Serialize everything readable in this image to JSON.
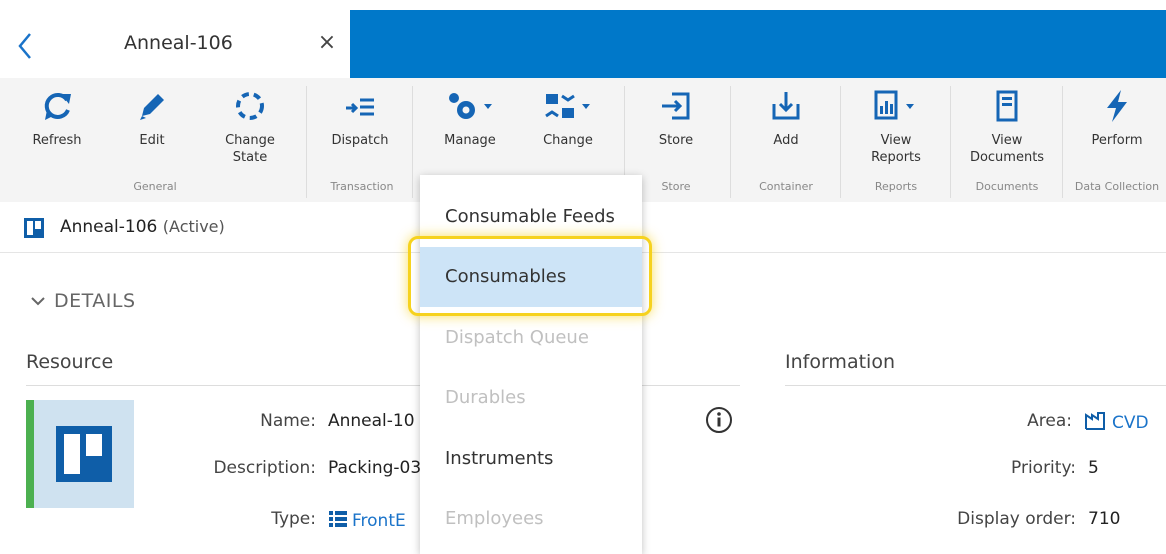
{
  "tab": {
    "title": "Anneal-106",
    "close_label": "×"
  },
  "ribbon": {
    "buttons": [
      {
        "label": "Refresh",
        "icon": "refresh-icon"
      },
      {
        "label": "Edit",
        "icon": "pencil-icon"
      },
      {
        "label": "Change State",
        "icon": "change-state-icon"
      },
      {
        "label": "Dispatch",
        "icon": "dispatch-icon"
      },
      {
        "label": "Manage",
        "icon": "gears-icon"
      },
      {
        "label": "Change",
        "icon": "change-icon"
      },
      {
        "label": "Store",
        "icon": "store-icon"
      },
      {
        "label": "Add",
        "icon": "add-download-icon"
      },
      {
        "label": "View Reports",
        "icon": "report-icon"
      },
      {
        "label": "View Documents",
        "icon": "document-icon"
      },
      {
        "label": "Perform",
        "icon": "lightning-icon"
      }
    ],
    "groups": {
      "general": "General",
      "transaction": "Transaction",
      "store": "Store",
      "container": "Container",
      "reports": "Reports",
      "documents": "Documents",
      "data_collection": "Data Collection"
    }
  },
  "crumb": {
    "title": "Anneal-106",
    "status": "(Active)"
  },
  "details": {
    "toggle_label": "DETAILS",
    "resource_heading": "Resource",
    "information_heading": "Information",
    "resource_fields": [
      {
        "label": "Name:",
        "value": "Anneal-10"
      },
      {
        "label": "Description:",
        "value": "Packing-03"
      },
      {
        "label": "Type:",
        "value": "FrontE"
      }
    ],
    "info_fields": [
      {
        "label": "Area:",
        "value": "CVD"
      },
      {
        "label": "Priority:",
        "value": "5"
      },
      {
        "label": "Display order:",
        "value": "710"
      }
    ]
  },
  "dropdown": {
    "items": [
      {
        "label": "Consumable Feeds",
        "enabled": true
      },
      {
        "label": "Consumables",
        "enabled": true,
        "selected": true
      },
      {
        "label": "Dispatch Queue",
        "enabled": false
      },
      {
        "label": "Durables",
        "enabled": false
      },
      {
        "label": "Instruments",
        "enabled": true
      },
      {
        "label": "Employees",
        "enabled": false
      }
    ]
  },
  "colors": {
    "accent": "#0078c9",
    "link": "#1a73c9",
    "status_green": "#4cb050",
    "highlight": "#f6d21e"
  }
}
